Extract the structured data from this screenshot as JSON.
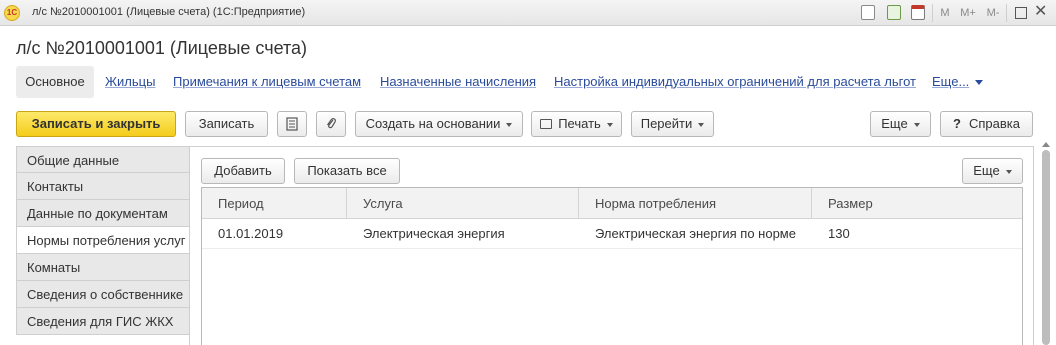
{
  "window": {
    "logo_text": "1С",
    "title": "л/с №2010001001 (Лицевые счета)  (1С:Предприятие)",
    "mem_labels": [
      "M",
      "M+",
      "M-"
    ]
  },
  "page": {
    "title": "л/с №2010001001 (Лицевые счета)"
  },
  "nav": {
    "active": "Основное",
    "links": [
      "Жильцы",
      "Примечания к лицевым счетам",
      "Назначенные начисления",
      "Настройка индивидуальных ограничений для расчета льгот"
    ],
    "more": "Еще..."
  },
  "toolbar": {
    "save_close": "Записать и закрыть",
    "save": "Записать",
    "create_based": "Создать на основании",
    "print": "Печать",
    "goto": "Перейти",
    "more": "Еще",
    "help": "Справка",
    "help_glyph": "?"
  },
  "tabs": [
    "Общие данные",
    "Контакты",
    "Данные по документам",
    "Нормы потребления услуг",
    "Комнаты",
    "Сведения о собственнике",
    "Сведения для ГИС ЖКХ"
  ],
  "active_tab_index": 3,
  "table_toolbar": {
    "add": "Добавить",
    "show_all": "Показать все",
    "more": "Еще"
  },
  "table": {
    "columns": [
      "Период",
      "Услуга",
      "Норма потребления",
      "Размер"
    ],
    "rows": [
      [
        "01.01.2019",
        "Электрическая энергия",
        "Электрическая энергия по норме",
        "130"
      ]
    ]
  },
  "colors": {
    "accent_yellow": "#f4cc1b",
    "link_blue": "#2a4b9b"
  }
}
